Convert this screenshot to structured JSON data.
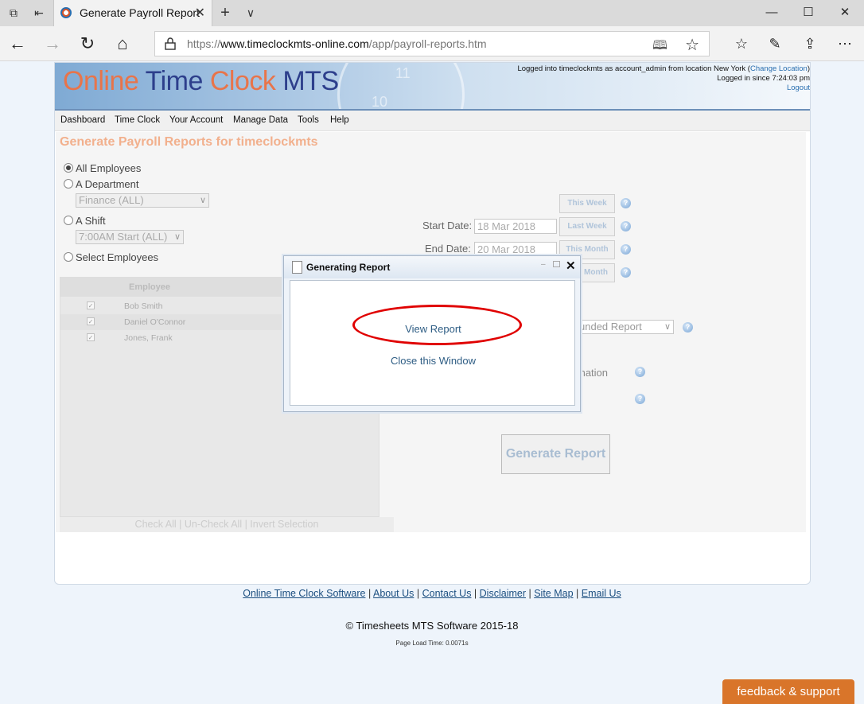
{
  "browser": {
    "tab_title": "Generate Payroll Report",
    "url_prefix": "https://",
    "url_host": "www.timeclockmts-online.com",
    "url_path": "/app/payroll-reports.htm"
  },
  "banner": {
    "logo_online": "Online",
    "logo_time": "Time",
    "logo_clock": "Clock",
    "logo_mts": "MTS",
    "clock_numbers": [
      "11",
      "10"
    ],
    "login_line1": "Logged into timeclockmts as account_admin from location New York (",
    "change_location": "Change Location",
    "login_line1_end": ")",
    "login_line2": "Logged in since 7:24:03 pm",
    "logout": "Logout"
  },
  "menu": [
    "Dashboard",
    "Time Clock",
    "Your Account",
    "Manage Data",
    "Tools",
    "Help"
  ],
  "content": {
    "title": "Generate Payroll Reports for timeclockmts",
    "radio_all": "All Employees",
    "radio_department": "A Department",
    "department_value": "Finance (ALL)",
    "radio_shift": "A Shift",
    "shift_value": "7:00AM Start (ALL)",
    "radio_select": "Select Employees",
    "employee_header": "Employee",
    "employees": [
      "Bob Smith",
      "Daniel O'Connor",
      "Jones, Frank"
    ],
    "check_links": "Check All | Un-Check All | Invert Selection",
    "start_label": "Start Date:",
    "start_value": "18 Mar 2018",
    "end_label": "End Date:",
    "end_value": "20 Mar 2018",
    "btn_this_week": "This Week",
    "btn_last_week": "Last Week",
    "btn_this_month": "This Month",
    "btn_last_month_frag": "Month",
    "report_type_frag": "unded Report",
    "information_frag": "mation",
    "generate_button": "Generate Report"
  },
  "dialog": {
    "title": "Generating Report",
    "view_report": "View Report",
    "close_window": "Close this Window"
  },
  "footer": {
    "links": [
      "Online Time Clock Software",
      "About Us",
      "Contact Us",
      "Disclaimer",
      "Site Map",
      "Email Us"
    ],
    "copyright": "© Timesheets MTS Software 2015-18",
    "load_time": "Page Load Time: 0.0071s",
    "feedback": "feedback & support"
  },
  "colors": {
    "accent_orange": "#e8744a",
    "brand_navy": "#2d3f8c",
    "highlight_red": "#e00000",
    "feedback_bg": "#d9752a"
  },
  "icons": [
    "tab-manager-icon",
    "back-tabs-icon",
    "close-icon",
    "plus-icon",
    "chevron-down-icon",
    "minimize-icon",
    "maximize-icon",
    "back-arrow-icon",
    "forward-arrow-icon",
    "refresh-icon",
    "home-icon",
    "lock-icon",
    "reading-view-icon",
    "star-icon",
    "favorites-icon",
    "pen-icon",
    "share-icon",
    "more-icon",
    "help-icon",
    "document-icon"
  ]
}
